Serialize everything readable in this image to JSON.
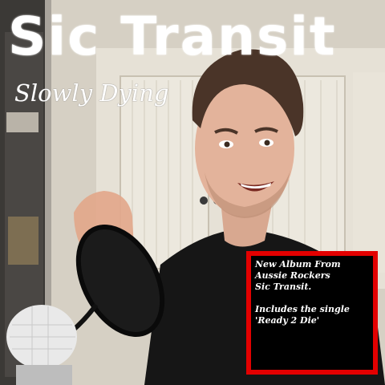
{
  "cover": {
    "band_name": "Sic Transit",
    "album_title": "Slowly Dying",
    "info_lines": [
      "New Album From",
      "Aussie Rockers",
      "Sic Transit.",
      "Includes the single",
      "'Ready 2 Die'"
    ]
  },
  "colors": {
    "title_text": "#ffffff",
    "box_border": "#e30000",
    "box_background": "#000000"
  }
}
